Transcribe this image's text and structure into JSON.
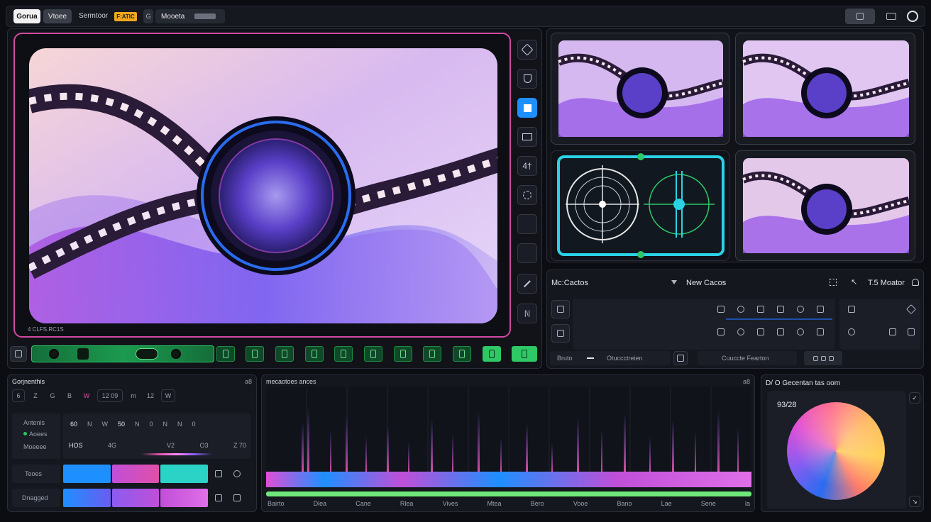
{
  "topbar": {
    "tab1": "Gorua",
    "tab2": "Vtoee",
    "section": "Sermtoor",
    "badge": "F:ATIC",
    "search_icon": "G",
    "mode": "Mooeta",
    "mode_pill": "",
    "right_btn1": "",
    "right_btn2": "",
    "right_btn3": ""
  },
  "preview": {
    "caption": "4 CLFS.RC1S",
    "accent_border": "#e04fa8"
  },
  "tools": [
    "pointer",
    "shield",
    "select",
    "rect",
    "text",
    "crop",
    "blank1",
    "blank2",
    "pen",
    "split"
  ],
  "media_panel": {
    "title": "Mc:Cactos",
    "filter_label": "New Cacos",
    "right_label": "T.5 Moator",
    "footer_left": "Bruto",
    "footer_mid": "Otuccctreien",
    "footer_search": "Cuuccte Fearton"
  },
  "composition": {
    "title": "Gorjnenthis",
    "corner": "a8",
    "toolbar": [
      "6",
      "Z",
      "G",
      "B",
      "W",
      "12 09",
      "m",
      "12",
      "W"
    ],
    "rows": [
      {
        "label": "Antenis",
        "sub": "Aoees",
        "extra": "Moeeee",
        "values": [
          "60",
          "N",
          "W",
          "50",
          "N",
          "0",
          "N",
          "N",
          "0"
        ]
      },
      {
        "label": "",
        "sub": "",
        "extra": "",
        "values": [
          "HOS",
          "4G",
          "",
          "V2",
          "O3",
          "Z 70"
        ]
      }
    ],
    "track1_label": "Teoes",
    "track2_label": "Dnagged"
  },
  "waveform": {
    "title": "mecaotoes ances",
    "corner": "a8",
    "footer": [
      "Bairto",
      "Dlea",
      "Cane",
      "Rlea",
      "Vives",
      "Mtea",
      "Bero",
      "Vooe",
      "Bano",
      "Lae",
      "Sene",
      "la"
    ]
  },
  "color_panel": {
    "title": "D/ O Gecentan tas oom",
    "value": "93/28",
    "corner": "Check"
  },
  "colors": {
    "green": "#2ec866",
    "blue": "#1e8fff",
    "pink": "#e04fa8",
    "cyan": "#2bd2e6",
    "purple": "#8a5cf0"
  }
}
